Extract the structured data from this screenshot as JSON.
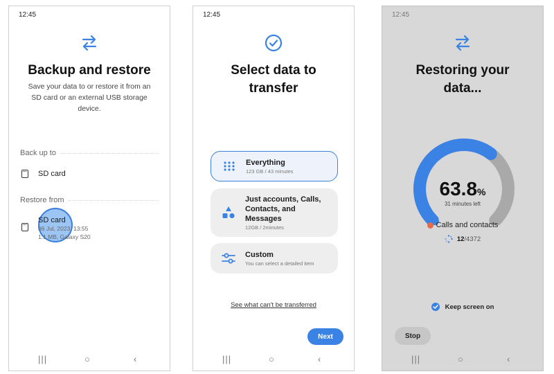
{
  "status_time": "12:45",
  "panel1": {
    "title": "Backup and restore",
    "description": "Save your data to or restore it from an SD card or an external USB storage device.",
    "backup_section": "Back up to",
    "backup_item": "SD card",
    "restore_section": "Restore from",
    "restore_item": {
      "name": "SD card",
      "date": "06 Jul, 2023, 13:55",
      "details": "1.1 MB, Galaxy S20"
    }
  },
  "panel2": {
    "title_line1": "Select data to",
    "title_line2": "transfer",
    "options": [
      {
        "name": "Everything",
        "sub": "123 GB / 43 minutes",
        "icon": "grid-dots-icon",
        "selected": true
      },
      {
        "name_lines": [
          "Just accounts, Calls,",
          "Contacts, and",
          "Messages"
        ],
        "sub": "12GB / 2minutes",
        "icon": "shapes-icon"
      },
      {
        "name": "Custom",
        "sub": "You can select a detailed item",
        "icon": "sliders-icon"
      }
    ],
    "link": "See what can't be transferred",
    "next_button": "Next"
  },
  "panel3": {
    "title_line1": "Restoring your",
    "title_line2": "data...",
    "percent": "63.8",
    "percent_unit": "%",
    "progress_fraction": 0.638,
    "time_left": "31 minutes left",
    "category": "Calls and contacts",
    "count_done": "12",
    "count_total": "/4372",
    "keep_screen_on": "Keep screen on",
    "stop_button": "Stop"
  },
  "colors": {
    "accent": "#3a82e4",
    "gauge_track": "#a9a9a9",
    "category_icon": "#e46b4c"
  },
  "nav": {
    "recent": "|||",
    "home": "○",
    "back": "‹"
  }
}
